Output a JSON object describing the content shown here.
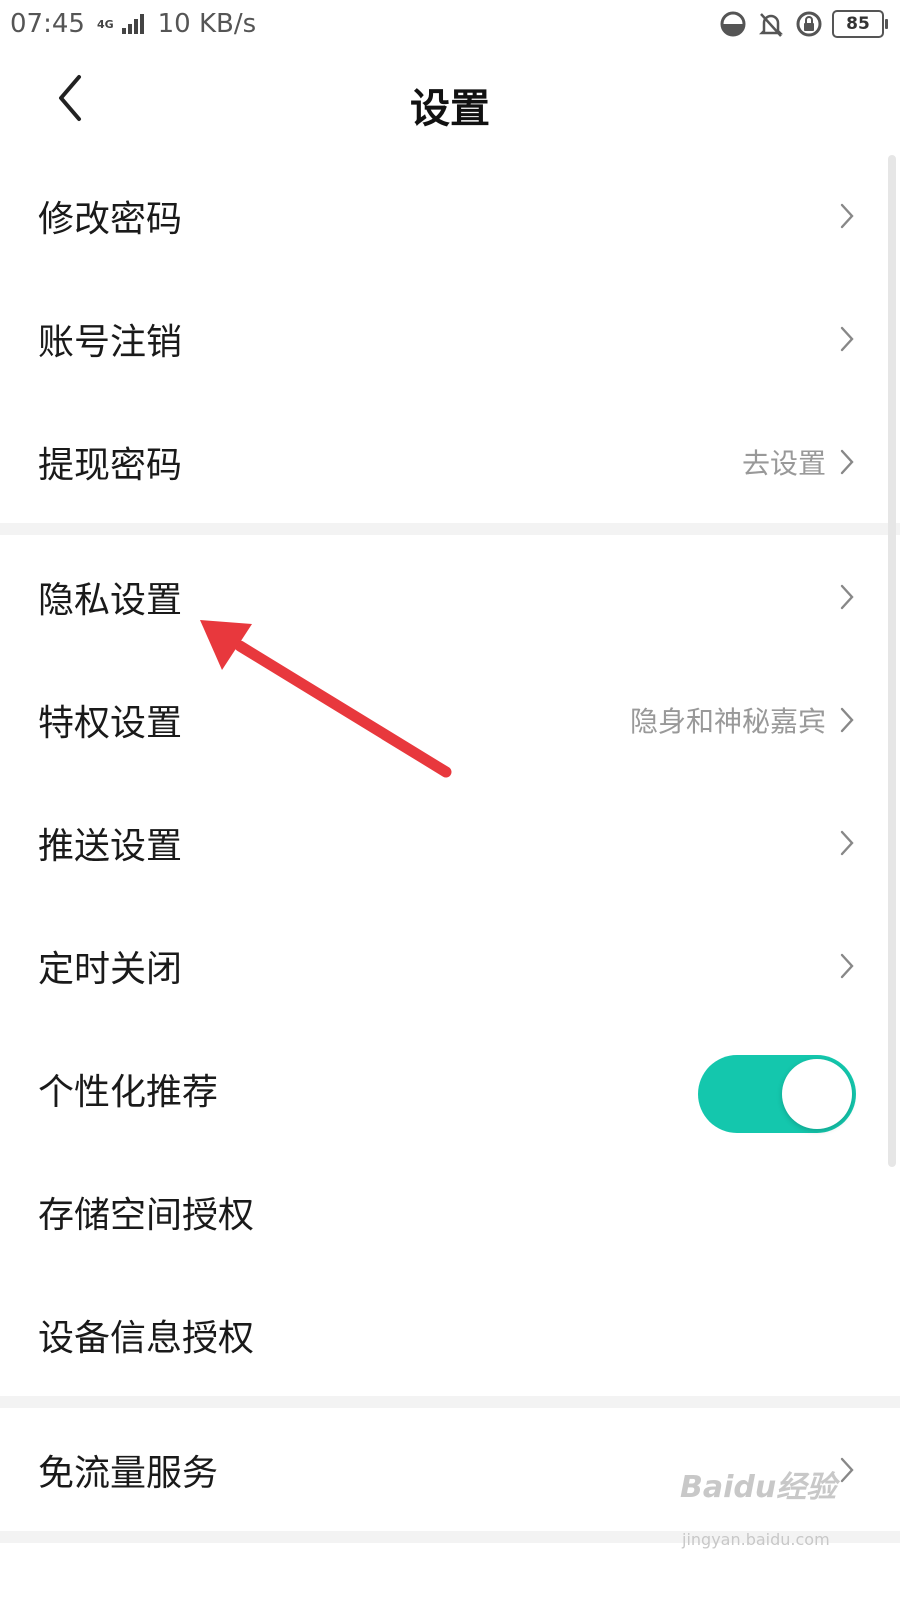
{
  "status_bar": {
    "time": "07:45",
    "network": "4G",
    "speed": "10 KB/s",
    "battery": "85"
  },
  "header": {
    "title": "设置",
    "back_icon": "chevron-left-icon"
  },
  "settings": {
    "group1": [
      {
        "label": "修改密码",
        "value": ""
      },
      {
        "label": "账号注销",
        "value": ""
      },
      {
        "label": "提现密码",
        "value": "去设置"
      }
    ],
    "group2": [
      {
        "label": "隐私设置",
        "value": ""
      },
      {
        "label": "特权设置",
        "value": "隐身和神秘嘉宾"
      },
      {
        "label": "推送设置",
        "value": ""
      },
      {
        "label": "定时关闭",
        "value": ""
      },
      {
        "label": "个性化推荐",
        "toggle": true
      },
      {
        "label": "存储空间授权"
      },
      {
        "label": "设备信息授权"
      }
    ],
    "group3": [
      {
        "label": "免流量服务",
        "value": ""
      }
    ]
  },
  "annotation": {
    "arrow_color": "#e8383d"
  },
  "colors": {
    "accent": "#14c7ad"
  },
  "watermark": {
    "text": "Baidu经验",
    "url": "jingyan.baidu.com"
  }
}
